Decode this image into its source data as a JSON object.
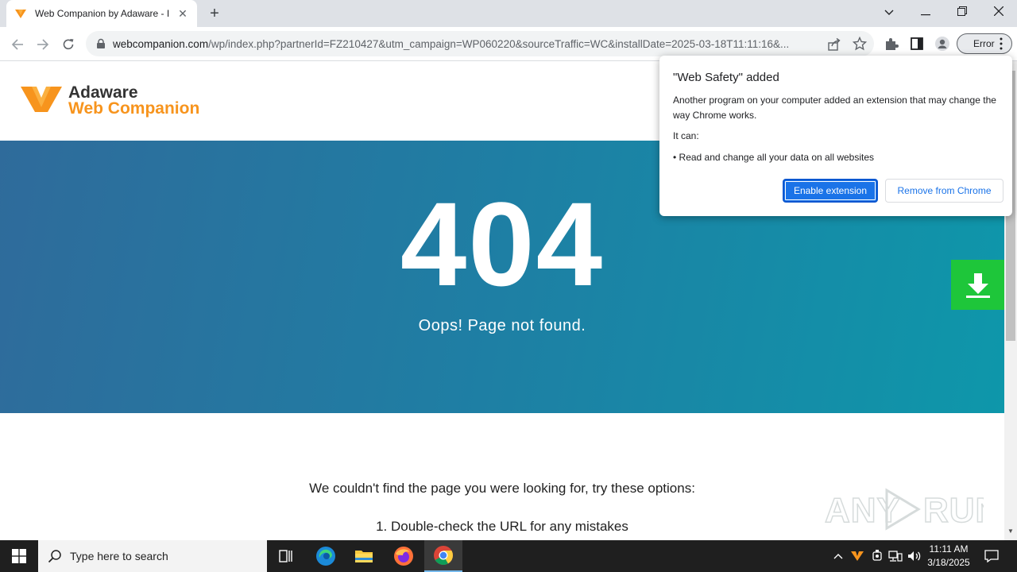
{
  "browser": {
    "tab_title": "Web Companion by Adaware - I",
    "url_host": "webcompanion.com",
    "url_path": "/wp/index.php?partnerId=FZ210427&utm_campaign=WP060220&sourceTraffic=WC&installDate=2025-03-18T11:11:16&...",
    "profile_chip": "Error"
  },
  "header": {
    "brand_line1": "Adaware",
    "brand_line2": "Web Companion"
  },
  "hero": {
    "code": "404",
    "message": "Oops! Page not found."
  },
  "body": {
    "line1": "We couldn't find the page you were looking for, try these options:",
    "line2": "1. Double-check the URL for any mistakes"
  },
  "watermark": "ANY RUN",
  "popup": {
    "title": "\"Web Safety\" added",
    "description": "Another program on your computer added an extension that may change the way Chrome works.",
    "can_label": "It can:",
    "permission": "• Read and change all your data on all websites",
    "enable_label": "Enable extension",
    "remove_label": "Remove from Chrome"
  },
  "taskbar": {
    "search_placeholder": "Type here to search",
    "time": "11:11 AM",
    "date": "3/18/2025"
  },
  "colors": {
    "brand_orange": "#f7941d",
    "hero_start": "#2f6b9b",
    "hero_end": "#0e97aa",
    "download_green": "#1ec63a",
    "chrome_blue": "#1a73e8"
  }
}
